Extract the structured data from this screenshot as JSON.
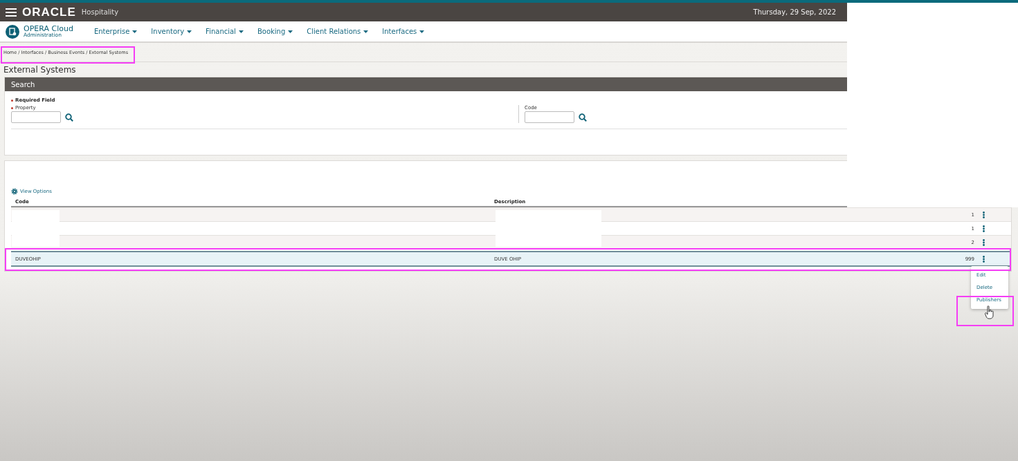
{
  "header": {
    "brand": "ORACLE",
    "product": "Hospitality",
    "date": "Thursday, 29 Sep, 2022"
  },
  "app": {
    "name": "OPERA Cloud",
    "module": "Administration"
  },
  "nav": [
    "Enterprise",
    "Inventory",
    "Financial",
    "Booking",
    "Client Relations",
    "Interfaces"
  ],
  "breadcrumb": "Home / Interfaces / Business Events / External Systems",
  "page_title": "External Systems",
  "search": {
    "title": "Search",
    "required_note": "Required Field",
    "fields": [
      {
        "label": "Property",
        "required": true
      },
      {
        "label": "Code",
        "required": false
      }
    ]
  },
  "results": {
    "view_options": "View Options",
    "columns": [
      "Code",
      "Description"
    ],
    "rows": [
      {
        "code": "",
        "description": "",
        "column_3": "1",
        "selected": false
      },
      {
        "code": "",
        "description": "",
        "column_3": "1",
        "selected": false
      },
      {
        "code": "",
        "description": "",
        "column_3": "2",
        "selected": false
      },
      {
        "code": "DUVEOHIP",
        "description": "DUVE OHIP",
        "column_3": "999",
        "selected": true
      }
    ]
  },
  "row_menu": [
    "Edit",
    "Delete",
    "Publishers"
  ]
}
